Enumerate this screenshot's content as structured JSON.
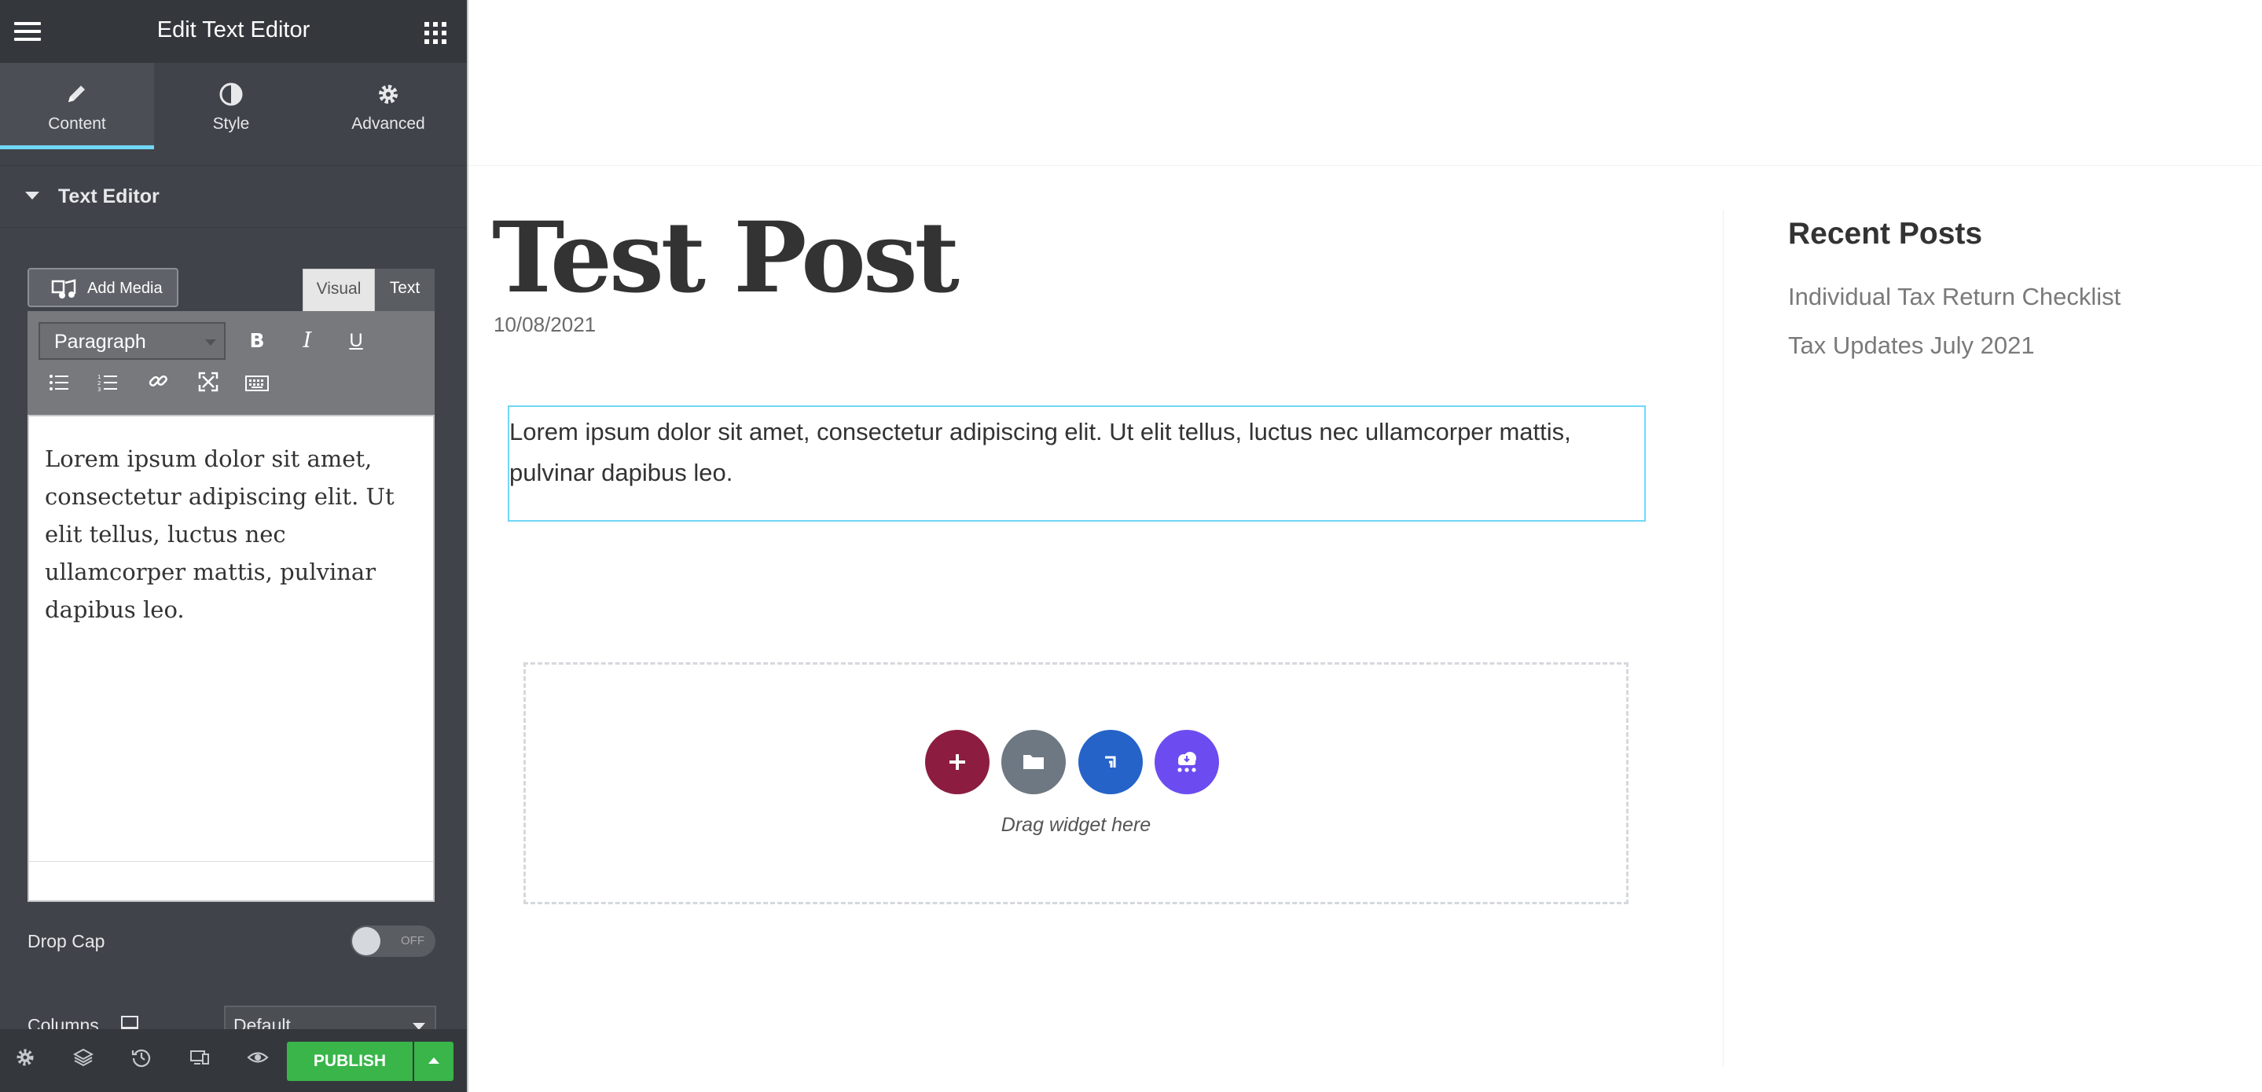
{
  "panel": {
    "title": "Edit Text Editor",
    "tabs": [
      {
        "label": "Content",
        "icon": "pencil-icon",
        "active": true
      },
      {
        "label": "Style",
        "icon": "half-circle-icon",
        "active": false
      },
      {
        "label": "Advanced",
        "icon": "gear-icon",
        "active": false
      }
    ],
    "section_title": "Text Editor",
    "add_media_label": "Add Media",
    "visual_tab": "Visual",
    "text_tab": "Text",
    "format_select": "Paragraph",
    "toolbar_icons": [
      "bold-icon",
      "italic-icon",
      "underline-icon",
      "bullet-list-icon",
      "numbered-list-icon",
      "link-icon",
      "fullscreen-icon",
      "keyboard-icon"
    ],
    "editor_content": "Lorem ipsum dolor sit amet, consectetur adipiscing elit. Ut elit tellus, luctus nec ullamcorper mattis, pulvinar dapibus leo.",
    "drop_cap_label": "Drop Cap",
    "drop_cap_state": "OFF",
    "columns_label": "Columns",
    "columns_value": "Default",
    "footer": {
      "icons": [
        "settings-icon",
        "layers-icon",
        "history-icon",
        "responsive-icon",
        "preview-eye-icon"
      ],
      "publish_label": "PUBLISH"
    },
    "accent_color": "#71d7f7",
    "publish_color": "#39b54a"
  },
  "preview": {
    "post_title": "Test Post",
    "post_date": "10/08/2021",
    "text_widget_content": "Lorem ipsum dolor sit amet, consectetur adipiscing elit. Ut elit tellus, luctus nec ullamcorper mattis, pulvinar dapibus leo.",
    "drop_hint": "Drag widget here",
    "drop_buttons": [
      {
        "icon": "plus-icon",
        "color": "#8c1d40"
      },
      {
        "icon": "folder-icon",
        "color": "#6d7882"
      },
      {
        "icon": "envato-icon",
        "color": "#2563c9"
      },
      {
        "icon": "cloud-ai-icon",
        "color": "#6c4cf0"
      }
    ],
    "sidebar": {
      "title": "Recent Posts",
      "links": [
        "Individual Tax Return Checklist",
        "Tax Updates July 2021"
      ]
    }
  }
}
